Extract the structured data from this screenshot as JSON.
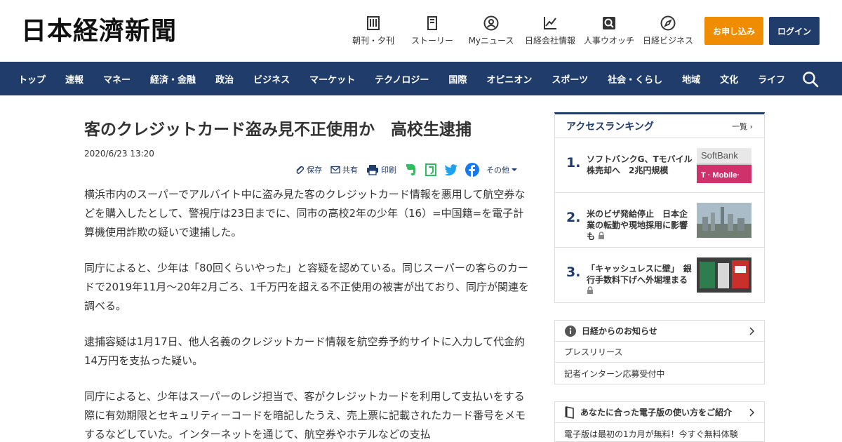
{
  "header": {
    "logo": "日本経濟新聞",
    "icons": [
      {
        "label": "朝刊・夕刊",
        "icon": "newspaper-icon"
      },
      {
        "label": "ストーリー",
        "icon": "book-icon"
      },
      {
        "label": "Myニュース",
        "icon": "user-icon"
      },
      {
        "label": "日経会社情報",
        "icon": "chart-icon"
      },
      {
        "label": "人事ウオッチ",
        "icon": "person-search-icon"
      },
      {
        "label": "日経ビジネス",
        "icon": "compass-icon"
      }
    ],
    "apply_label": "お申し込み",
    "login_label": "ログイン"
  },
  "nav": {
    "items": [
      "トップ",
      "速報",
      "マネー",
      "経済・金融",
      "政治",
      "ビジネス",
      "マーケット",
      "テクノロジー",
      "国際",
      "オピニオン",
      "スポーツ",
      "社会・くらし",
      "地域",
      "文化",
      "ライフ"
    ]
  },
  "article": {
    "title": "客のクレジットカード盗み見不正使用か　高校生逮捕",
    "date": "2020/6/23 13:20",
    "share": {
      "save": "保存",
      "share": "共有",
      "print": "印刷",
      "more": "その他"
    },
    "paragraphs": [
      "横浜市内のスーパーでアルバイト中に盗み見た客のクレジットカード情報を悪用して航空券などを購入したとして、警視庁は23日までに、同市の高校2年の少年（16）=中国籍=を電子計算機使用詐欺の疑いで逮捕した。",
      "同庁によると、少年は「80回くらいやった」と容疑を認めている。同じスーパーの客らのカードで2019年11月～20年2月ごろ、1千万円を超える不正使用の被害が出ており、同庁が関連を調べる。",
      "逮捕容疑は1月17日、他人名義のクレジットカード情報を航空券予約サイトに入力して代金約14万円を支払った疑い。",
      "同庁によると、少年はスーパーのレジ担当で、客がクレジットカードを利用して支払いをする際に有効期限とセキュリティーコードを暗記したうえ、売上票に記載されたカード番号をメモするなどしていた。インターネットを通じて、航空券やホテルなどの支払"
    ]
  },
  "ranking": {
    "title": "アクセスランキング",
    "more": "一覧",
    "items": [
      {
        "num": "1.",
        "text": "ソフトバンクG、Tモバイル株売却へ　2兆円規模",
        "locked": false
      },
      {
        "num": "2.",
        "text": "米のビザ発給停止　日本企業の転勤や現地採用に影響も",
        "locked": true
      },
      {
        "num": "3.",
        "text": "「キャッシュレスに壁」　銀行手数料下げへ外堀埋まる",
        "locked": true
      }
    ]
  },
  "notice": {
    "title": "日経からのお知らせ",
    "links": [
      "プレスリリース",
      "記者インターン応募受付中"
    ]
  },
  "ebook": {
    "title": "あなたに合った電子版の使い方をご紹介",
    "link": "電子版は最初の1カ月が無料！今すぐ無料体験"
  },
  "thumb_texts": {
    "softbank": "SoftBank",
    "tmobile": "T · Mobile·"
  },
  "colors": {
    "navy": "#1f3c6b",
    "orange": "#f08c00",
    "twitter": "#1da1f2",
    "facebook": "#1877f2",
    "evernote": "#2dbe60"
  }
}
